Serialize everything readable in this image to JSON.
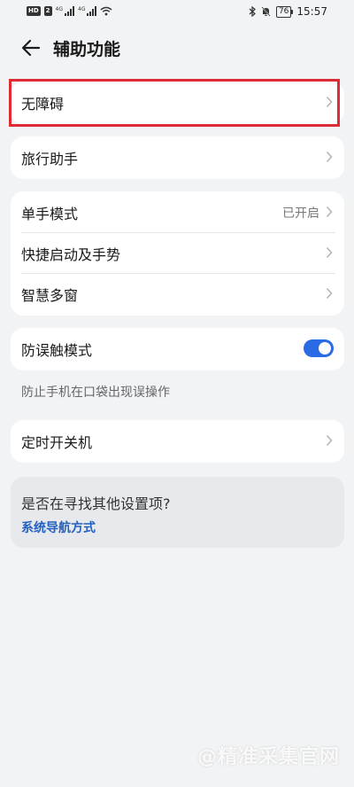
{
  "status_bar": {
    "hd_chip": "HD",
    "sim_chip": "2",
    "net_label_1": "4G",
    "net_label_2": "4G",
    "battery": "76",
    "time": "15:57"
  },
  "header": {
    "title": "辅助功能"
  },
  "sections": {
    "accessibility": {
      "label": "无障碍"
    },
    "travel": {
      "label": "旅行助手"
    },
    "group": [
      {
        "label": "单手模式",
        "value": "已开启"
      },
      {
        "label": "快捷启动及手势"
      },
      {
        "label": "智慧多窗"
      }
    ],
    "mistouch": {
      "label": "防误触模式",
      "enabled": true,
      "note": "防止手机在口袋出现误操作"
    },
    "schedule": {
      "label": "定时开关机"
    }
  },
  "suggestion": {
    "question": "是否在寻找其他设置项?",
    "link": "系统导航方式"
  },
  "watermark": "@精准采集官网",
  "colors": {
    "accent": "#2a6be5",
    "highlight": "#e02b33",
    "link": "#2361c2",
    "background": "#f1f3f5"
  }
}
